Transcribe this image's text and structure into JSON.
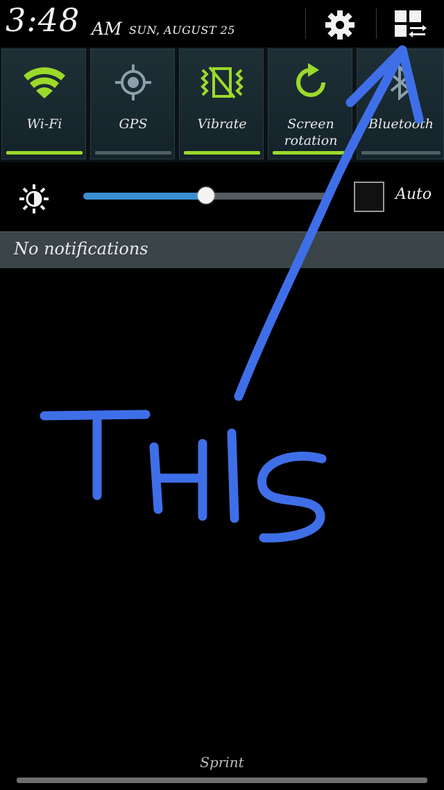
{
  "status": {
    "time": "3:48",
    "ampm": "AM",
    "date": "SUN, AUGUST 25"
  },
  "header": {
    "settings_icon": "gear-icon",
    "quick_settings_icon": "quick-settings-grid-icon"
  },
  "toggles": [
    {
      "label": "Wi-Fi",
      "icon": "wifi-icon",
      "enabled": true
    },
    {
      "label": "GPS",
      "icon": "gps-icon",
      "enabled": false
    },
    {
      "label": "Vibrate",
      "icon": "vibrate-icon",
      "enabled": true
    },
    {
      "label_line1": "Screen",
      "label_line2": "rotation",
      "icon": "screen-rotation-icon",
      "enabled": true
    },
    {
      "label": "Bluetooth",
      "icon": "bluetooth-icon",
      "enabled": false
    }
  ],
  "brightness": {
    "level": 0.5,
    "auto_label": "Auto",
    "auto_checked": false
  },
  "notifications": {
    "empty_text": "No notifications"
  },
  "annotation": {
    "text": "THIS",
    "color": "#3f6fe8"
  },
  "footer": {
    "carrier": "Sprint"
  },
  "colors": {
    "toggle_on": "#9bd92b",
    "toggle_off": "#4f5f66",
    "slider_fill": "#3a8fd0"
  }
}
